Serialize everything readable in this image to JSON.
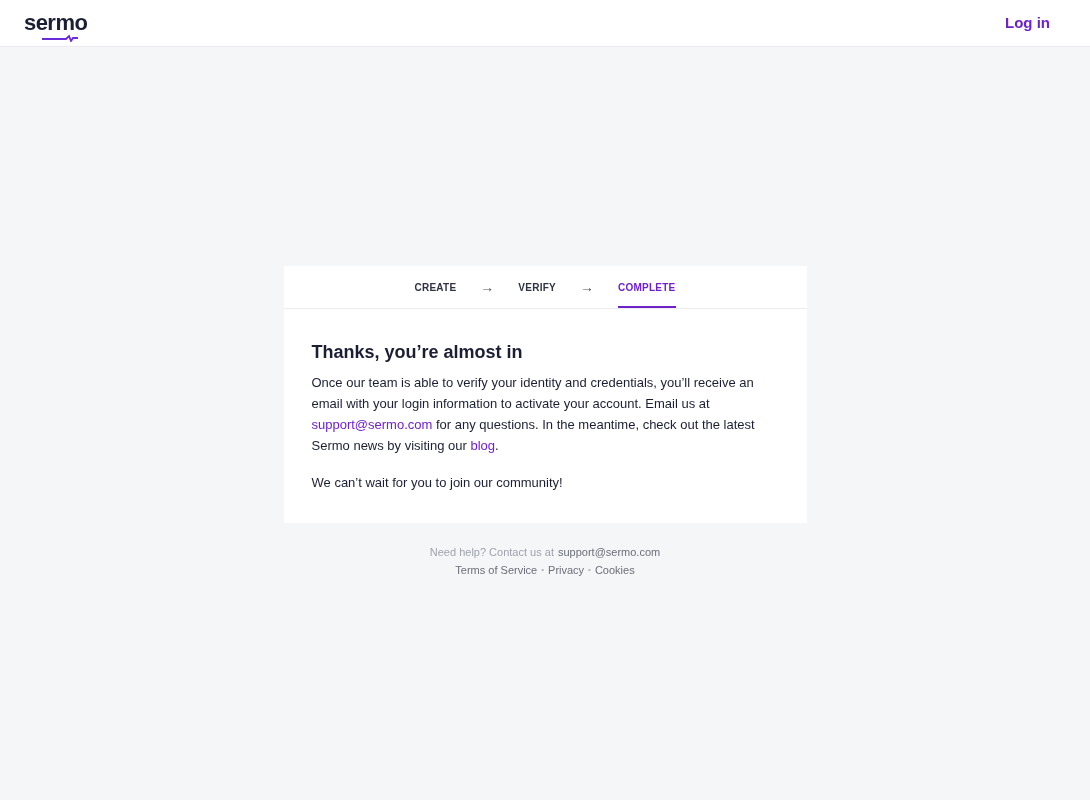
{
  "header": {
    "logo": "sermo",
    "login": "Log in"
  },
  "steps": [
    {
      "label": "CREATE",
      "selected": false
    },
    {
      "label": "VERIFY",
      "selected": false
    },
    {
      "label": "COMPLETE",
      "selected": true
    }
  ],
  "step_arrow": "→",
  "card": {
    "title": "Thanks, you’re almost in",
    "paragraphs": [
      [
        {
          "kind": "text",
          "text": "Once our team is able to verify your identity and credentials, you’ll receive an email with your login information to activate your account. Email us at "
        },
        {
          "kind": "link",
          "text": "support@sermo.com"
        },
        {
          "kind": "text",
          "text": " for any questions. In the meantime, check out the latest Sermo news by visiting our "
        },
        {
          "kind": "link",
          "text": "blog"
        },
        {
          "kind": "text",
          "text": "."
        }
      ],
      [
        {
          "kind": "text",
          "text": "We can’t wait for you to join our community!"
        }
      ]
    ]
  },
  "footer": {
    "help": "Need help? Contact us at",
    "email": "support@sermo.com",
    "links": [
      {
        "kind": "link",
        "text": "Terms of Service"
      },
      {
        "kind": "sep",
        "text": "•"
      },
      {
        "kind": "link",
        "text": "Privacy"
      },
      {
        "kind": "sep",
        "text": "•"
      },
      {
        "kind": "link",
        "text": "Cookies"
      }
    ]
  }
}
